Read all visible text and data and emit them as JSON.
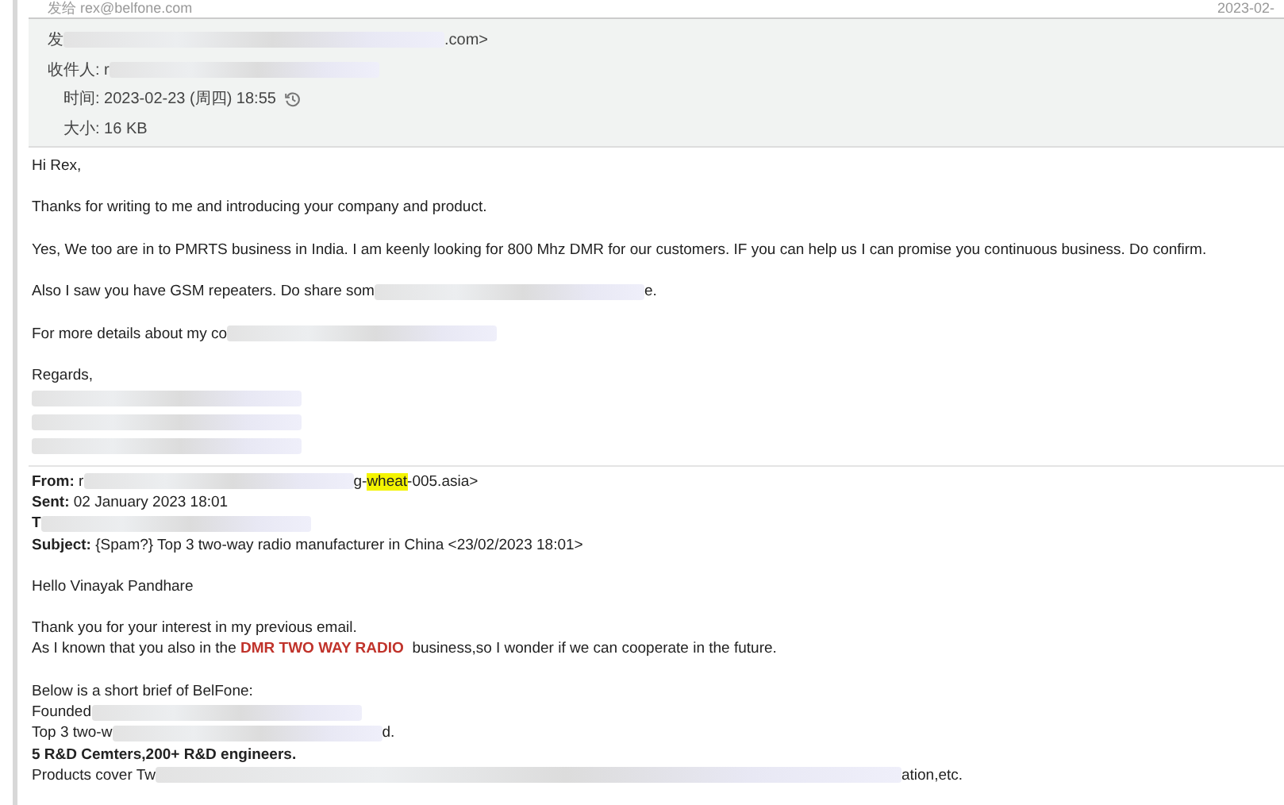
{
  "top_bar": {
    "recipient": "发给 rex@belfone.com",
    "date": "2023-02-"
  },
  "header": {
    "addresses": [
      {
        "parts": [
          {
            "kind": "text",
            "text": "发"
          },
          {
            "kind": "blur"
          },
          {
            "kind": "text",
            "text": ".com>"
          }
        ]
      },
      {
        "parts": [
          {
            "kind": "text",
            "text": "收件人: r"
          },
          {
            "kind": "blur"
          }
        ]
      }
    ],
    "details": [
      {
        "parts": [
          {
            "kind": "text",
            "text": "时间: 2023-02-23 (周四) 18:55"
          },
          {
            "kind": "history"
          }
        ]
      },
      {
        "parts": [
          {
            "kind": "text",
            "text": "大小: 16 KB"
          }
        ]
      }
    ]
  },
  "reply": [
    {
      "lines": [
        {
          "parts": [
            {
              "kind": "text",
              "text": "Hi Rex,"
            }
          ]
        }
      ]
    },
    {
      "lines": [
        {
          "parts": [
            {
              "kind": "text",
              "text": "Thanks for writing to me and introducing your company and product."
            }
          ]
        }
      ]
    },
    {
      "lines": [
        {
          "parts": [
            {
              "kind": "text",
              "text": "Yes, We too are in to PMRTS business in India. I am keenly looking for 800 Mhz DMR for our customers. IF you can help us I can promise you continuous business. Do confirm."
            }
          ]
        }
      ]
    },
    {
      "lines": [
        {
          "parts": [
            {
              "kind": "text",
              "text": "Also I saw you have GSM repeaters. Do share som"
            },
            {
              "kind": "blur"
            },
            {
              "kind": "text",
              "text": "e."
            }
          ]
        }
      ]
    },
    {
      "lines": [
        {
          "parts": [
            {
              "kind": "text",
              "text": "For more details about my co"
            },
            {
              "kind": "blur"
            }
          ]
        }
      ]
    },
    {
      "lines": [
        {
          "parts": [
            {
              "kind": "text",
              "text": "Regards,"
            }
          ]
        },
        {
          "parts": [
            {
              "kind": "blur"
            }
          ]
        },
        {
          "parts": [
            {
              "kind": "blur"
            }
          ]
        },
        {
          "parts": [
            {
              "kind": "blur"
            }
          ]
        }
      ]
    }
  ],
  "quoted": [
    {
      "lines": [
        {
          "parts": [
            {
              "kind": "text",
              "text": "**From:** r"
            },
            {
              "kind": "blur"
            },
            {
              "kind": "text",
              "text": "g-"
            },
            {
              "kind": "highlight",
              "text": "wheat"
            },
            {
              "kind": "text",
              "text": "-005.asia>"
            }
          ]
        },
        {
          "parts": [
            {
              "kind": "text",
              "text": "**Sent:** 02 January 2023 18:01"
            }
          ]
        },
        {
          "parts": [
            {
              "kind": "text",
              "text": "**T**"
            },
            {
              "kind": "blur"
            }
          ]
        },
        {
          "parts": [
            {
              "kind": "text",
              "text": "**Subject:** {Spam?} Top 3 two-way radio manufacturer in China <23/02/2023 18:01>"
            }
          ]
        }
      ]
    },
    {
      "lines": [
        {
          "parts": [
            {
              "kind": "text",
              "text": "Hello Vinayak Pandhare"
            }
          ]
        }
      ]
    },
    {
      "lines": [
        {
          "parts": [
            {
              "kind": "text",
              "text": "Thank you for your interest in my previous email."
            }
          ]
        },
        {
          "parts": [
            {
              "kind": "text",
              "text": "As I known that you also in the "
            },
            {
              "kind": "emphasis",
              "text": "DMR TWO WAY RADIO"
            },
            {
              "kind": "text",
              "text": "  business,so I wonder if we can cooperate in the future."
            }
          ]
        }
      ]
    },
    {
      "lines": [
        {
          "parts": [
            {
              "kind": "text",
              "text": "Below is a short brief of BelFone:"
            }
          ]
        },
        {
          "parts": [
            {
              "kind": "text",
              "text": "Founded"
            },
            {
              "kind": "blur"
            }
          ]
        },
        {
          "parts": [
            {
              "kind": "text",
              "text": "Top 3 two-w"
            },
            {
              "kind": "blur"
            },
            {
              "kind": "text",
              "text": "d."
            }
          ]
        },
        {
          "parts": [
            {
              "kind": "bold",
              "text": "5 R&D Cemters,200+ R&D engineers."
            }
          ]
        },
        {
          "parts": [
            {
              "kind": "text",
              "text": "Products cover Tw"
            },
            {
              "kind": "blur"
            },
            {
              "kind": "text",
              "text": "ation,etc."
            }
          ]
        }
      ]
    }
  ]
}
